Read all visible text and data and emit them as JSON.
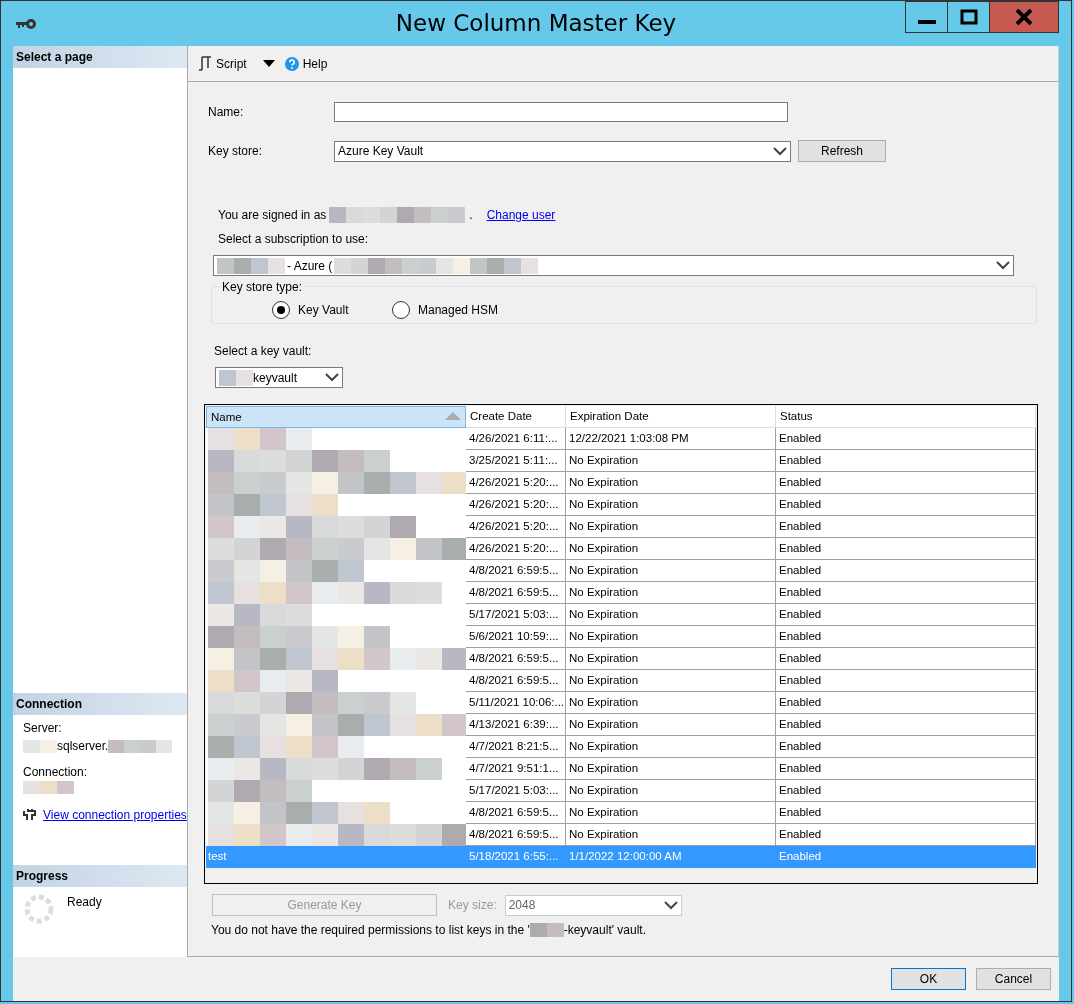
{
  "window": {
    "title": "New Column Master Key"
  },
  "sidebar": {
    "select_page": {
      "heading": "Select a page"
    },
    "connection": {
      "heading": "Connection",
      "server_label": "Server:",
      "server_value": "sqlserver.",
      "connection_label": "Connection:",
      "link": "View connection properties"
    },
    "progress": {
      "heading": "Progress",
      "status": "Ready"
    }
  },
  "toolbar": {
    "script": "Script",
    "help": "Help"
  },
  "form": {
    "name_label": "Name:",
    "key_store_label": "Key store:",
    "key_store_value": "Azure Key Vault",
    "refresh": "Refresh",
    "signed_in_text": "You are signed in as",
    "signed_in_end": ".",
    "change_user": "Change user",
    "subscription_label": "Select a subscription to use:",
    "subscription_value": "- Azure (",
    "key_store_type": {
      "legend": "Key store type:",
      "options": [
        {
          "label": "Key Vault",
          "selected": true
        },
        {
          "label": "Managed HSM",
          "selected": false
        }
      ]
    },
    "key_vault_label": "Select a key vault:",
    "key_vault_value": "keyvault"
  },
  "table": {
    "columns": [
      "Name",
      "Create Date",
      "Expiration Date",
      "Status"
    ],
    "rows": [
      {
        "create_date": "4/26/2021 6:11:...",
        "expiration_date": "12/22/2021 1:03:08 PM",
        "status": "Enabled",
        "selected": false
      },
      {
        "create_date": "3/25/2021 5:11:...",
        "expiration_date": "No Expiration",
        "status": "Enabled",
        "selected": false
      },
      {
        "create_date": "4/26/2021 5:20:...",
        "expiration_date": "No Expiration",
        "status": "Enabled",
        "selected": false
      },
      {
        "create_date": "4/26/2021 5:20:...",
        "expiration_date": "No Expiration",
        "status": "Enabled",
        "selected": false
      },
      {
        "create_date": "4/26/2021 5:20:...",
        "expiration_date": "No Expiration",
        "status": "Enabled",
        "selected": false
      },
      {
        "create_date": "4/26/2021 5:20:...",
        "expiration_date": "No Expiration",
        "status": "Enabled",
        "selected": false
      },
      {
        "create_date": "4/8/2021 6:59:5...",
        "expiration_date": "No Expiration",
        "status": "Enabled",
        "selected": false
      },
      {
        "create_date": "4/8/2021 6:59:5...",
        "expiration_date": "No Expiration",
        "status": "Enabled",
        "selected": false
      },
      {
        "create_date": "5/17/2021 5:03:...",
        "expiration_date": "No Expiration",
        "status": "Enabled",
        "selected": false
      },
      {
        "create_date": "5/6/2021 10:59:...",
        "expiration_date": "No Expiration",
        "status": "Enabled",
        "selected": false
      },
      {
        "create_date": "4/8/2021 6:59:5...",
        "expiration_date": "No Expiration",
        "status": "Enabled",
        "selected": false
      },
      {
        "create_date": "4/8/2021 6:59:5...",
        "expiration_date": "No Expiration",
        "status": "Enabled",
        "selected": false
      },
      {
        "create_date": "5/11/2021 10:06:...",
        "expiration_date": "No Expiration",
        "status": "Enabled",
        "selected": false
      },
      {
        "create_date": "4/13/2021 6:39:...",
        "expiration_date": "No Expiration",
        "status": "Enabled",
        "selected": false
      },
      {
        "create_date": "4/7/2021 8:21:5...",
        "expiration_date": "No Expiration",
        "status": "Enabled",
        "selected": false
      },
      {
        "create_date": "4/7/2021 9:51:1...",
        "expiration_date": "No Expiration",
        "status": "Enabled",
        "selected": false
      },
      {
        "create_date": "5/17/2021 5:03:...",
        "expiration_date": "No Expiration",
        "status": "Enabled",
        "selected": false
      },
      {
        "create_date": "4/8/2021 6:59:5...",
        "expiration_date": "No Expiration",
        "status": "Enabled",
        "selected": false
      },
      {
        "create_date": "4/8/2021 6:59:5...",
        "expiration_date": "No Expiration",
        "status": "Enabled",
        "selected": false
      },
      {
        "name": "test",
        "create_date": "5/18/2021 6:55:...",
        "expiration_date": "1/1/2022 12:00:00 AM",
        "status": "Enabled",
        "selected": true
      }
    ]
  },
  "generate_key": {
    "label": "Generate Key",
    "disabled": true
  },
  "key_size": {
    "label": "Key size:",
    "value": "2048",
    "disabled": true
  },
  "message": {
    "before": "You do not have the required permissions to list keys in the '",
    "after": "-keyvault' vault."
  },
  "buttons": [
    "OK",
    "Cancel"
  ]
}
